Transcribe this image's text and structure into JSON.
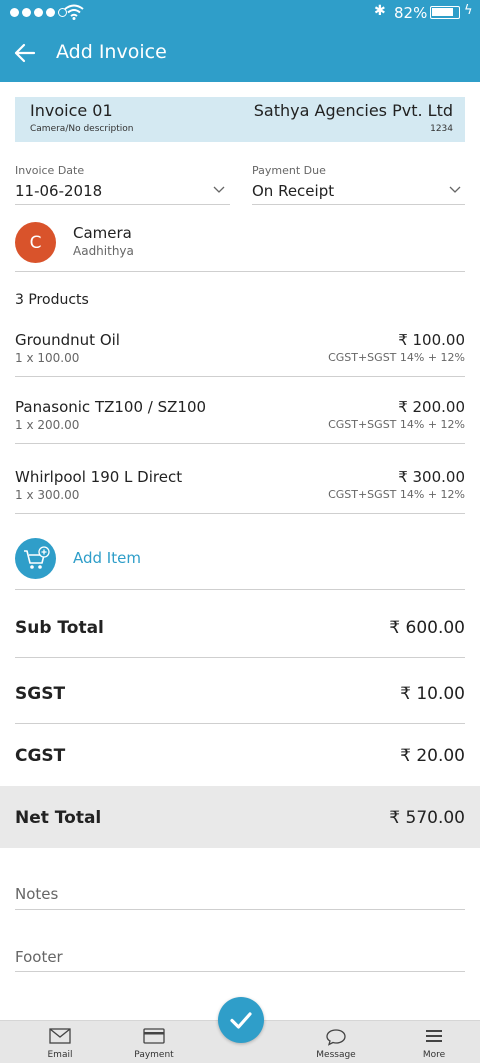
{
  "status": {
    "battery_pct": "82%",
    "battery_level": 0.82
  },
  "header": {
    "title": "Add Invoice"
  },
  "invoice": {
    "number": "Invoice 01",
    "description": "Camera/No description",
    "company": "Sathya Agencies Pvt. Ltd",
    "code": "1234"
  },
  "fields": {
    "invoice_date_label": "Invoice Date",
    "invoice_date_value": "11-06-2018",
    "payment_due_label": "Payment Due",
    "payment_due_value": "On Receipt"
  },
  "customer": {
    "initial": "C",
    "name": "Camera",
    "subtitle": "Aadhithya"
  },
  "products_count": "3 Products",
  "products": [
    {
      "name": "Groundnut Oil",
      "qty": "1 x 100.00",
      "price": "₹ 100.00",
      "tax": "CGST+SGST 14% + 12%"
    },
    {
      "name": "Panasonic TZ100 / SZ100",
      "qty": "1 x 200.00",
      "price": "₹ 200.00",
      "tax": "CGST+SGST 14% + 12%"
    },
    {
      "name": "Whirlpool 190 L Direct",
      "qty": "1 x 300.00",
      "price": "₹ 300.00",
      "tax": "CGST+SGST 14% + 12%"
    }
  ],
  "add_item_label": "Add Item",
  "totals": {
    "sub_total_label": "Sub Total",
    "sub_total_value": "₹ 600.00",
    "sgst_label": "SGST",
    "sgst_value": "₹ 10.00",
    "cgst_label": "CGST",
    "cgst_value": "₹ 20.00",
    "net_total_label": "Net Total",
    "net_total_value": "₹ 570.00"
  },
  "notes_label": "Notes",
  "footer_label": "Footer",
  "tabs": {
    "email": "Email",
    "payment": "Payment",
    "message": "Message",
    "more": "More"
  },
  "colors": {
    "primary": "#2f9ec9",
    "avatar": "#d9532b",
    "net_total_bg": "#e9e9e9",
    "card_bg": "#d4e9f2"
  }
}
